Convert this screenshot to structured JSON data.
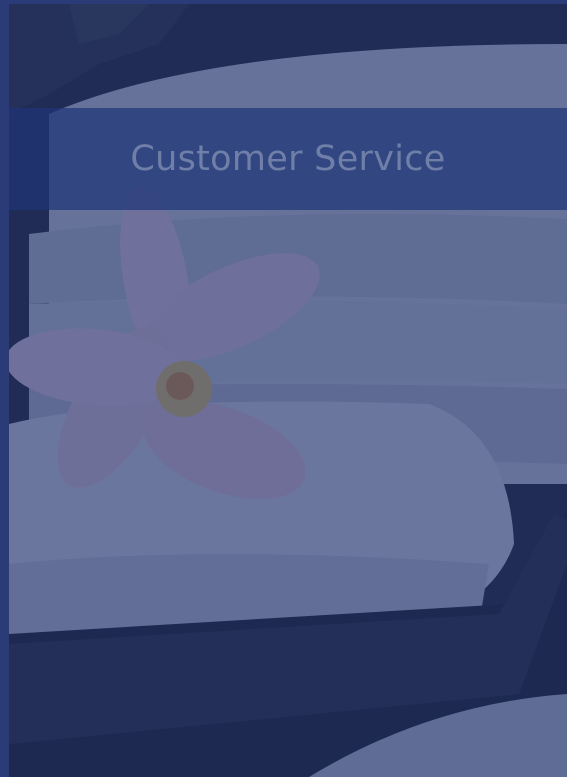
{
  "card": {
    "title": "Customer Service",
    "overlay_color": "#1e306e",
    "banner_color": "#1e3478",
    "title_color": "#6f7fa8",
    "image_icon": "spa-towels-flower-image"
  }
}
